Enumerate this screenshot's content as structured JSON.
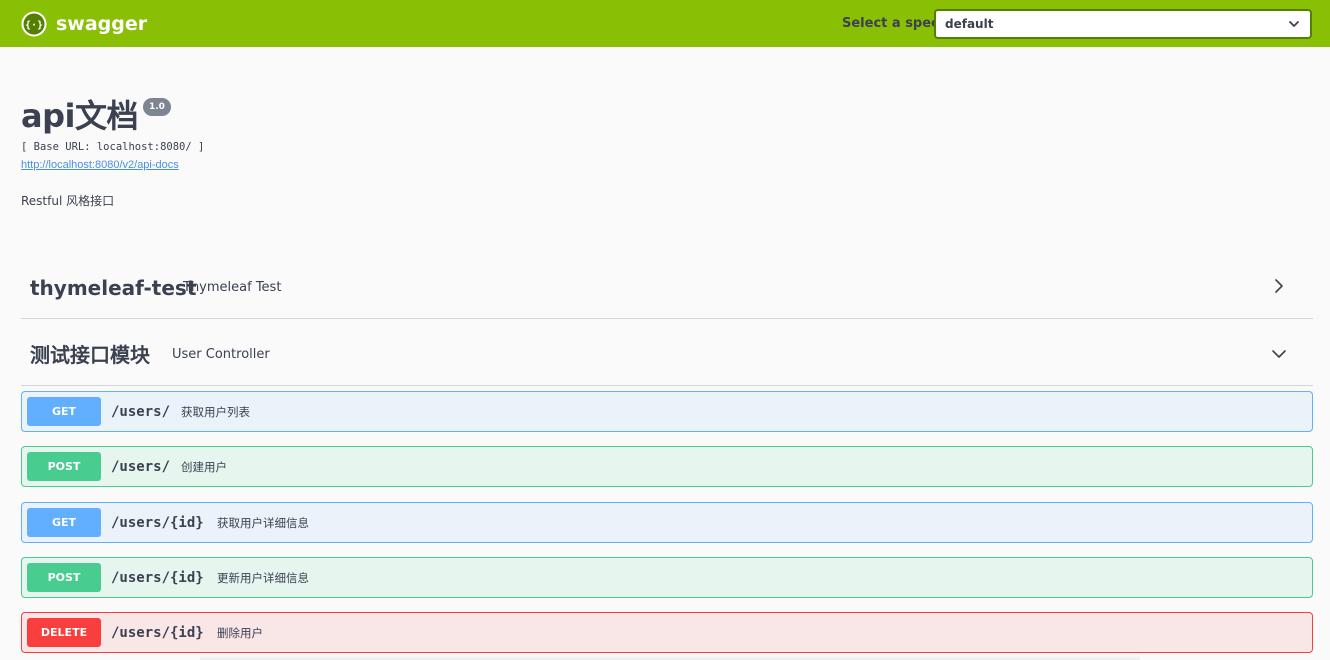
{
  "topbar": {
    "logo_text": "swagger",
    "logo_icon": "swagger-braces-icon",
    "spec_label": "Select a spec",
    "spec_value": "default",
    "color": "#89bf04"
  },
  "info": {
    "title": "api文档",
    "version": "1.0",
    "base_url": "[ Base URL: localhost:8080/ ]",
    "api_docs_url": "http://localhost:8080/v2/api-docs",
    "description": "Restful 风格接口"
  },
  "tags": [
    {
      "name": "thymeleaf-test",
      "description": "Thymeleaf Test",
      "arrow_icon": "chevron-right-icon"
    },
    {
      "name": "测试接口模块",
      "description": "User Controller",
      "arrow_icon": "chevron-down-icon"
    }
  ],
  "operations": [
    {
      "method": "GET",
      "path": "/users/",
      "summary": "获取用户列表",
      "color": "#61affe"
    },
    {
      "method": "POST",
      "path": "/users/",
      "summary": "创建用户",
      "color": "#49cc90"
    },
    {
      "method": "GET",
      "path": "/users/{id}",
      "summary": "获取用户详细信息",
      "color": "#61affe"
    },
    {
      "method": "POST",
      "path": "/users/{id}",
      "summary": "更新用户详细信息",
      "color": "#49cc90"
    },
    {
      "method": "DELETE",
      "path": "/users/{id}",
      "summary": "删除用户",
      "color": "#f93e3e"
    }
  ]
}
